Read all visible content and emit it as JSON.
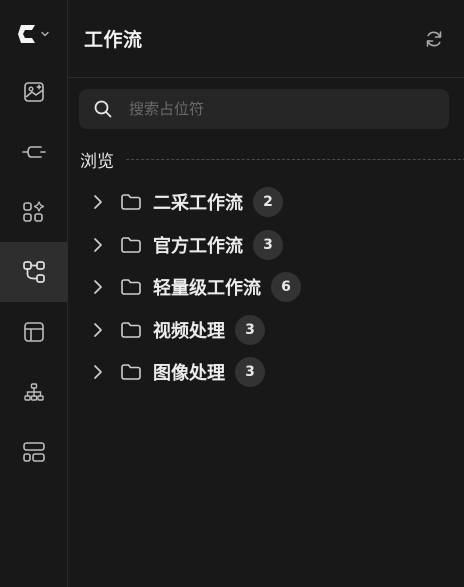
{
  "header": {
    "title": "工作流"
  },
  "search": {
    "placeholder": "搜索占位符",
    "value": ""
  },
  "browse": {
    "label": "浏览"
  },
  "rail": {
    "items": [
      {
        "icon": "image-icon"
      },
      {
        "icon": "connector-icon"
      },
      {
        "icon": "apps-sparkle-icon"
      },
      {
        "icon": "workflow-icon",
        "active": true
      },
      {
        "icon": "layout-icon"
      },
      {
        "icon": "hierarchy-icon"
      },
      {
        "icon": "template-icon"
      }
    ]
  },
  "folders": [
    {
      "label": "二采工作流",
      "count": "2"
    },
    {
      "label": "官方工作流",
      "count": "3"
    },
    {
      "label": "轻量级工作流",
      "count": "6"
    },
    {
      "label": "视频处理",
      "count": "3"
    },
    {
      "label": "图像处理",
      "count": "3"
    }
  ],
  "colors": {
    "background": "#181818",
    "active_rail": "#2e2e2e",
    "search_bg": "#262626",
    "badge_bg": "#333333",
    "text": "#e8e8e8"
  }
}
